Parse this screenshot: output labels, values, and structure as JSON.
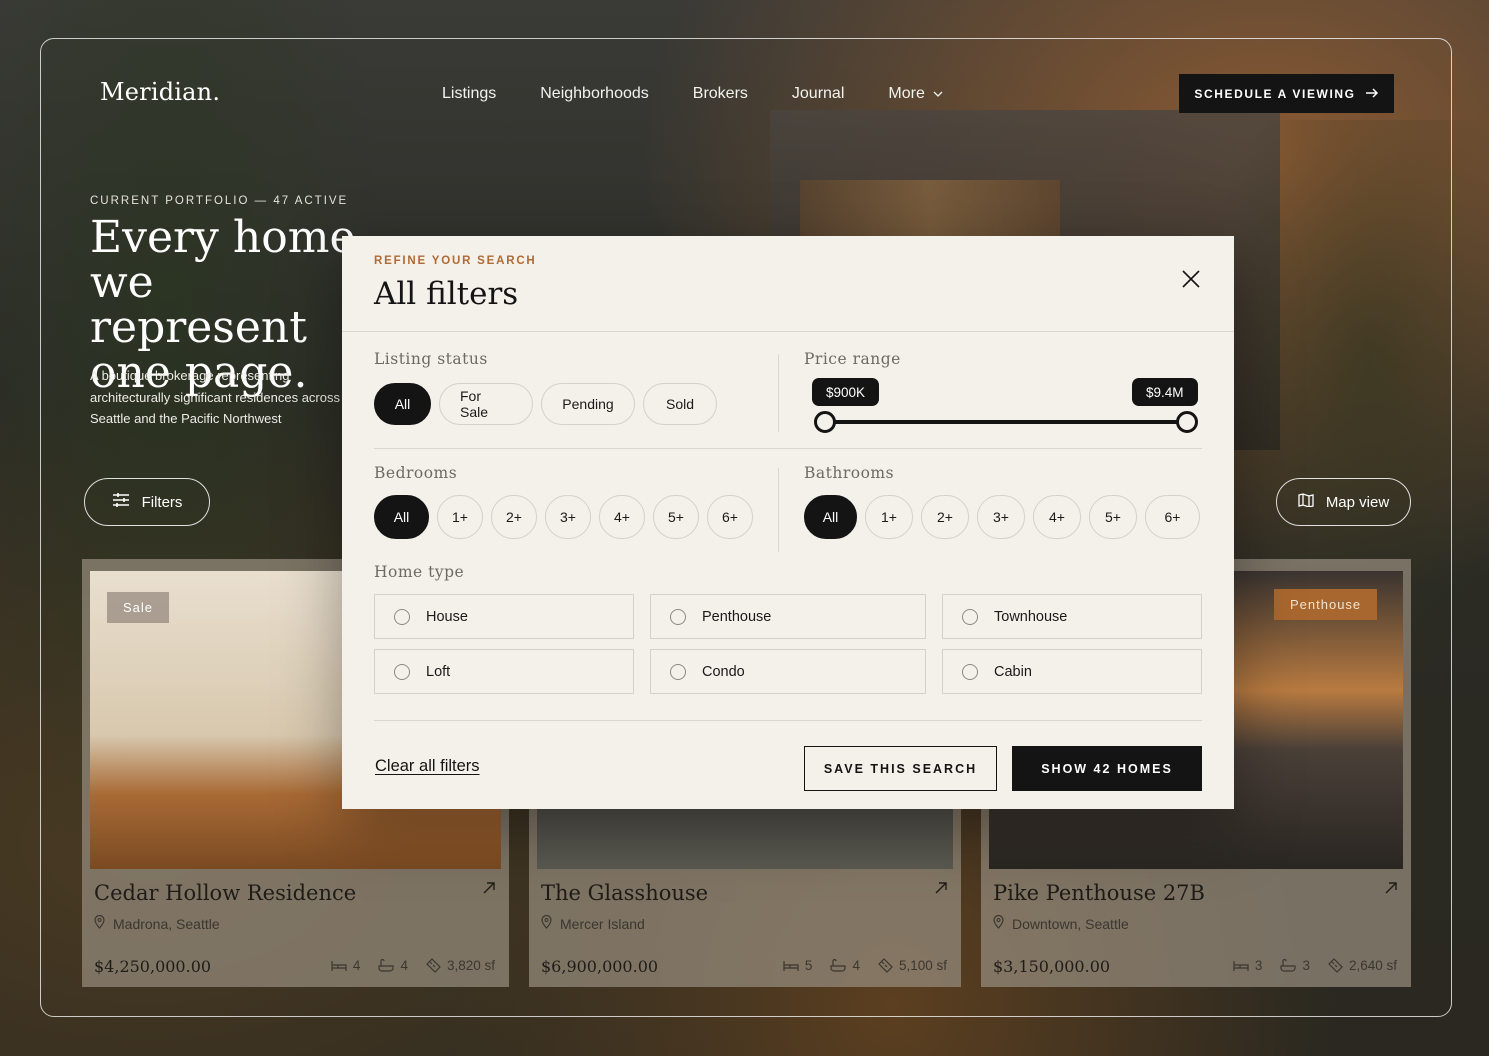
{
  "brand": {
    "logo": "Meridian."
  },
  "nav": {
    "items": [
      "Listings",
      "Neighborhoods",
      "Brokers",
      "Journal",
      "More"
    ],
    "cta": "SCHEDULE A VIEWING"
  },
  "hero": {
    "eyebrow": "CURRENT PORTFOLIO — 47 ACTIVE",
    "headline": "Every home we represent one page.",
    "subcopy": "A boutique brokerage representing architecturally significant residences across Seattle and the Pacific Northwest",
    "filters_button": "Filters",
    "map_button": "Map view"
  },
  "listings": [
    {
      "badge": "Sale",
      "title": "Cedar Hollow Residence",
      "location": "Madrona, Seattle",
      "price": "$4,250,000.00",
      "beds": "4",
      "baths": "4",
      "area": "3,820 sf"
    },
    {
      "badge": "",
      "title": "The Glasshouse",
      "location": "Mercer Island",
      "price": "$6,900,000.00",
      "beds": "5",
      "baths": "4",
      "area": "5,100 sf"
    },
    {
      "badge": "Penthouse",
      "title": "Pike Penthouse 27B",
      "location": "Downtown, Seattle",
      "price": "$3,150,000.00",
      "beds": "3",
      "baths": "3",
      "area": "2,640 sf"
    }
  ],
  "modal": {
    "eyebrow": "REFINE YOUR SEARCH",
    "title": "All filters",
    "listing_status": {
      "label": "Listing status",
      "options": [
        "All",
        "For Sale",
        "Pending",
        "Sold"
      ],
      "selected": "All"
    },
    "price_range": {
      "label": "Price range",
      "min_label": "$900K",
      "max_label": "$9.4M"
    },
    "bedrooms": {
      "label": "Bedrooms",
      "options": [
        "All",
        "1+",
        "2+",
        "3+",
        "4+",
        "5+",
        "6+"
      ],
      "selected": "All"
    },
    "bathrooms": {
      "label": "Bathrooms",
      "options": [
        "All",
        "1+",
        "2+",
        "3+",
        "4+",
        "5+",
        "6+"
      ],
      "selected": "All"
    },
    "home_type": {
      "label": "Home type",
      "options": [
        "House",
        "Penthouse",
        "Townhouse",
        "Loft",
        "Condo",
        "Cabin"
      ]
    },
    "clear": "Clear all filters",
    "save": "SAVE THIS SEARCH",
    "show": "SHOW 42 HOMES"
  },
  "colors": {
    "accent": "#b06a35",
    "ink": "#141414",
    "paper": "#f4f1ea",
    "penthouse_badge": "#a8672e"
  }
}
